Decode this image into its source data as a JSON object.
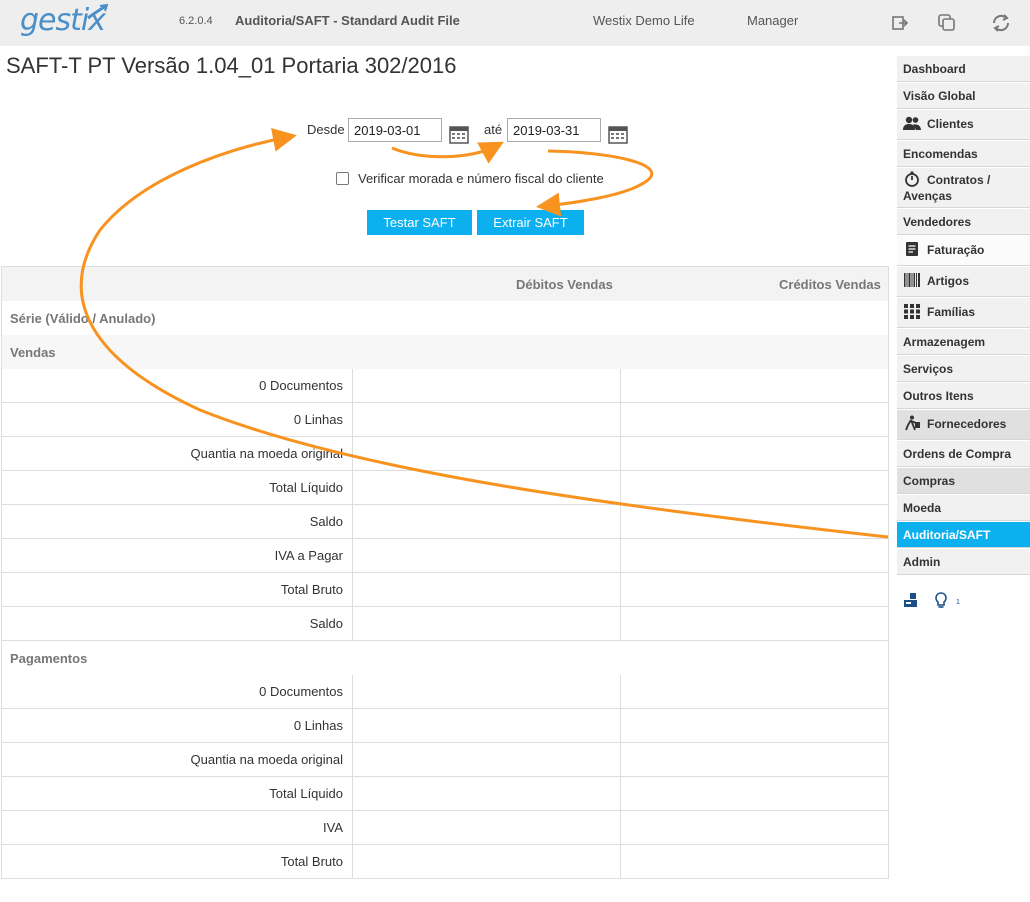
{
  "topbar": {
    "logo": "gestix",
    "version": "6.2.0.4",
    "title": "Auditoria/SAFT - Standard Audit File",
    "company": "Westix Demo Life",
    "role": "Manager"
  },
  "page": {
    "title": "SAFT-T PT Versão 1.04_01 Portaria 302/2016"
  },
  "form": {
    "from_label": "Desde",
    "from_value": "2019-03-01",
    "to_label": "até",
    "to_value": "2019-03-31",
    "checkbox_label": "Verificar morada e número fiscal do cliente",
    "test_button": "Testar SAFT",
    "extract_button": "Extrair SAFT"
  },
  "table": {
    "headers": [
      "Débitos Vendas",
      "Créditos Vendas"
    ],
    "series_label": "Série (Válido / Anulado)",
    "sections": [
      {
        "name": "Vendas",
        "rows": [
          "0 Documentos",
          "0 Linhas",
          "Quantia na moeda original",
          "Total Líquido",
          "Saldo",
          "IVA a Pagar",
          "Total Bruto",
          "Saldo"
        ]
      },
      {
        "name": "Pagamentos",
        "rows": [
          "0 Documentos",
          "0 Linhas",
          "Quantia na moeda original",
          "Total Líquido",
          "IVA",
          "Total Bruto"
        ]
      }
    ]
  },
  "sidebar": {
    "items": [
      {
        "label": "Dashboard"
      },
      {
        "label": "Visão Global"
      },
      {
        "label": "Clientes",
        "icon": "users-icon"
      },
      {
        "label": "Encomendas"
      },
      {
        "label": "Contratos / Avenças",
        "icon": "stopwatch-icon"
      },
      {
        "label": "Vendedores"
      },
      {
        "label": "Faturação",
        "icon": "document-icon"
      },
      {
        "label": "Artigos",
        "icon": "barcode-icon"
      },
      {
        "label": "Famílias",
        "icon": "grid-icon"
      },
      {
        "label": "Armazenagem"
      },
      {
        "label": "Serviços"
      },
      {
        "label": "Outros Itens"
      },
      {
        "label": "Fornecedores",
        "icon": "porter-icon"
      },
      {
        "label": "Ordens de Compra"
      },
      {
        "label": "Compras"
      },
      {
        "label": "Moeda"
      },
      {
        "label": "Auditoria/SAFT"
      },
      {
        "label": "Admin"
      }
    ],
    "footer_badge": "1"
  },
  "colors": {
    "accent": "#0cb0ef",
    "annotation": "#f7931e"
  }
}
